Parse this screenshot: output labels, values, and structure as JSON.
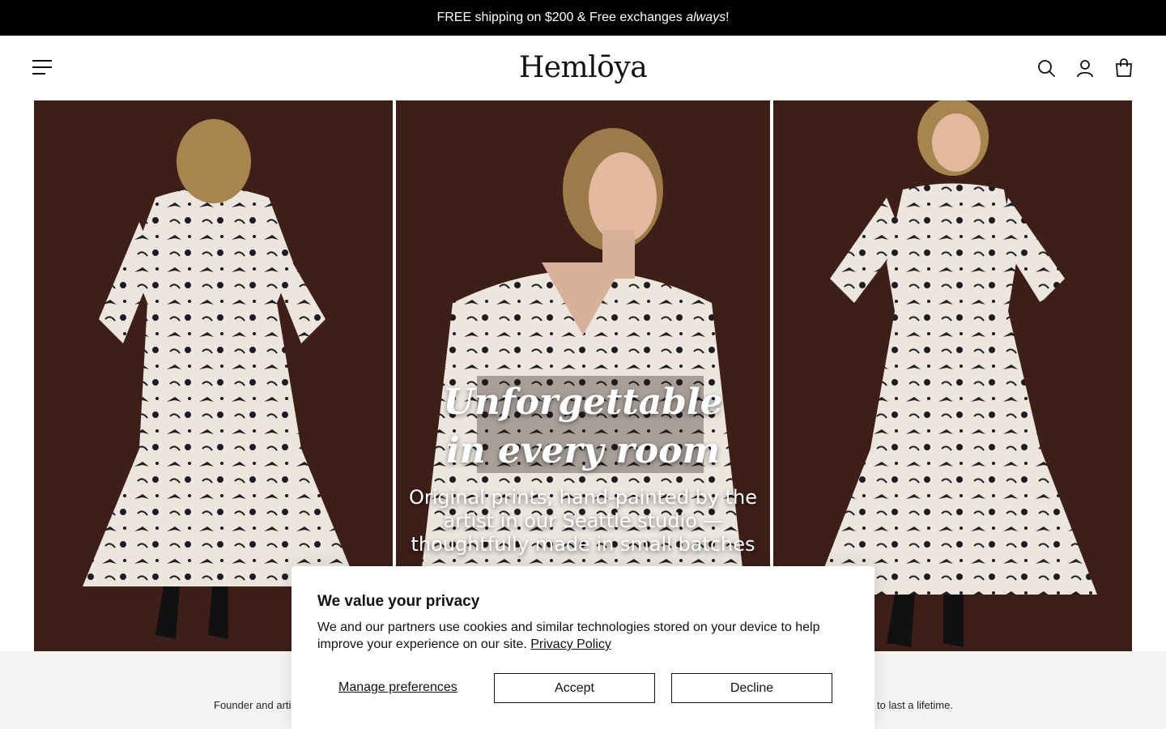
{
  "announcement": {
    "prefix": "FREE shipping on $200 & Free exchanges ",
    "emphasis": "always",
    "suffix": "!"
  },
  "header": {
    "logo": "Hemlōya",
    "icons": [
      "menu-icon",
      "search-icon",
      "account-icon",
      "cart-icon"
    ]
  },
  "hero": {
    "headline_line1": "Unforgettable",
    "headline_line2": "in every room",
    "subline": "Original prints, hand-painted by the artist in our Seattle studio — thoughtfully made in small batches",
    "background_color": "#3d1f18",
    "dress_color": "#ece6df"
  },
  "below": {
    "founder_text_left": "Founder and artis",
    "founder_text_right": "to last a lifetime."
  },
  "cookie_banner": {
    "title": "We value your privacy",
    "text": "We and our partners use cookies and similar technologies stored on your device to help improve your experience on our site.",
    "privacy_link": "Privacy Policy",
    "manage_label": "Manage preferences",
    "accept_label": "Accept",
    "decline_label": "Decline"
  }
}
